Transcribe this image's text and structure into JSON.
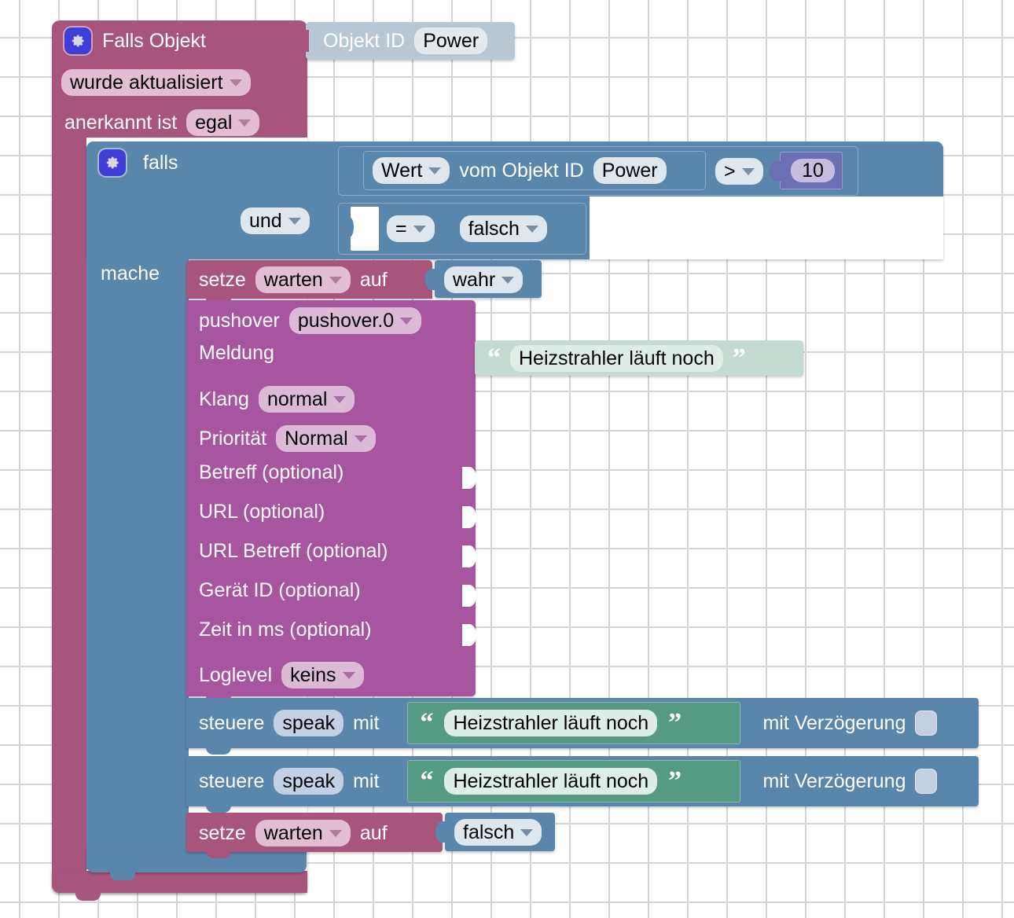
{
  "workspace": {
    "grid": "dot-cross-grid",
    "colors": {
      "trigger": "#a8557e",
      "control": "#5b86ab",
      "object_id": "#b7c8d4",
      "number": "#6d6fb4",
      "pushover": "#a855a0",
      "text_mint": "#c3dcd2",
      "text_green": "#559b83",
      "gear_icon": "#3f3fd8"
    }
  },
  "trigger_block": {
    "gear_icon": "gear-icon",
    "title": "Falls Objekt",
    "object_id_label": "Objekt ID",
    "object_id_value": "Power",
    "change_type": "wurde aktualisiert",
    "ack_label": "anerkannt ist",
    "ack_value": "egal"
  },
  "if_block": {
    "gear_icon": "gear-icon",
    "label": "falls",
    "do_label": "mache",
    "operator": "und",
    "condition1": {
      "selector": "Wert",
      "middle_label": "vom Objekt ID",
      "object_id": "Power",
      "comparison": ">",
      "number": "10"
    },
    "condition2": {
      "left_socket": "",
      "comparison": "=",
      "value": "falsch"
    }
  },
  "set_true_block": {
    "verb": "setze",
    "variable": "warten",
    "preposition": "auf",
    "value": "wahr"
  },
  "pushover_block": {
    "title": "pushover",
    "instance": "pushover.0",
    "rows": [
      {
        "label": "Meldung",
        "value": "Heizstrahler läuft noch",
        "kind": "text"
      },
      {
        "label": "Klang",
        "value": "normal",
        "kind": "dropdown"
      },
      {
        "label": "Priorität",
        "value": "Normal",
        "kind": "dropdown"
      },
      {
        "label": "Betreff (optional)",
        "value": "",
        "kind": "socket"
      },
      {
        "label": "URL (optional)",
        "value": "",
        "kind": "socket"
      },
      {
        "label": "URL Betreff (optional)",
        "value": "",
        "kind": "socket"
      },
      {
        "label": "Gerät ID (optional)",
        "value": "",
        "kind": "socket"
      },
      {
        "label": "Zeit in ms (optional)",
        "value": "",
        "kind": "socket"
      },
      {
        "label": "Loglevel",
        "value": "keins",
        "kind": "dropdown"
      }
    ]
  },
  "speak_blocks": [
    {
      "verb": "steuere",
      "target": "speak",
      "with_label": "mit",
      "text": "Heizstrahler läuft noch",
      "delay_label": "mit Verzögerung",
      "delay_checked": false
    },
    {
      "verb": "steuere",
      "target": "speak",
      "with_label": "mit",
      "text": "Heizstrahler läuft noch",
      "delay_label": "mit Verzögerung",
      "delay_checked": false
    }
  ],
  "set_false_block": {
    "verb": "setze",
    "variable": "warten",
    "preposition": "auf",
    "value": "falsch"
  },
  "quotes": {
    "open": "“",
    "close": "”"
  }
}
